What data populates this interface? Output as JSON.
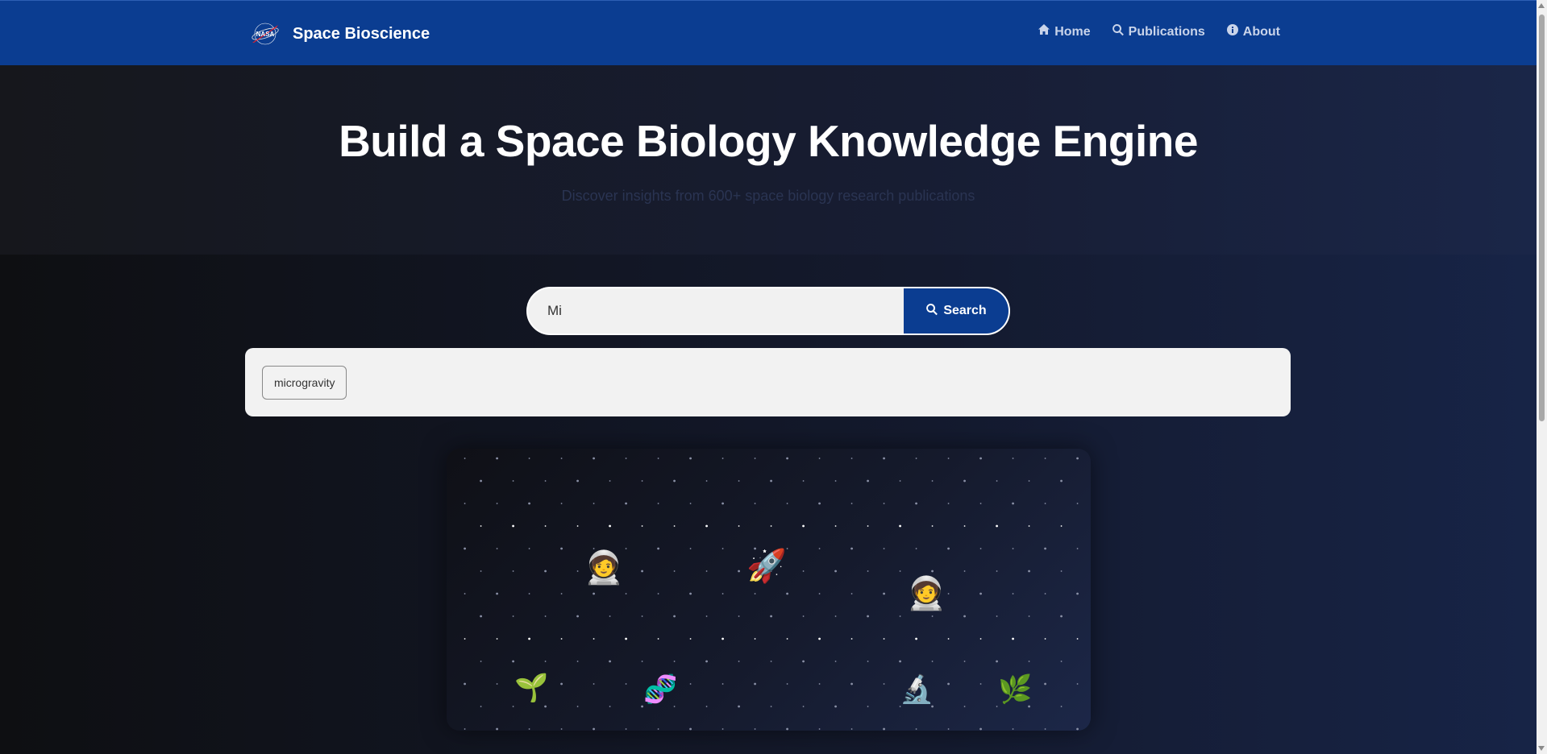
{
  "navbar": {
    "brand_text": "Space Bioscience",
    "logo_icon": "nasa-logo-icon",
    "links": [
      {
        "label": "Home",
        "icon": "home-icon"
      },
      {
        "label": "Publications",
        "icon": "search-icon"
      },
      {
        "label": "About",
        "icon": "info-icon"
      }
    ]
  },
  "hero": {
    "title": "Build a Space Biology Knowledge Engine",
    "subtitle": "Discover insights from 600+ space biology research publications"
  },
  "search": {
    "value": "Mi",
    "button_label": "Search"
  },
  "suggestions": [
    "microgravity"
  ],
  "illustration": {
    "emojis": [
      "🧑‍🚀",
      "🚀",
      "🧑‍🚀",
      "🌱",
      "🧬",
      "🔬",
      "🌿"
    ]
  },
  "colors": {
    "navbar": "#0b3d91",
    "accent": "#0b3d91",
    "background": "#141a2e"
  }
}
